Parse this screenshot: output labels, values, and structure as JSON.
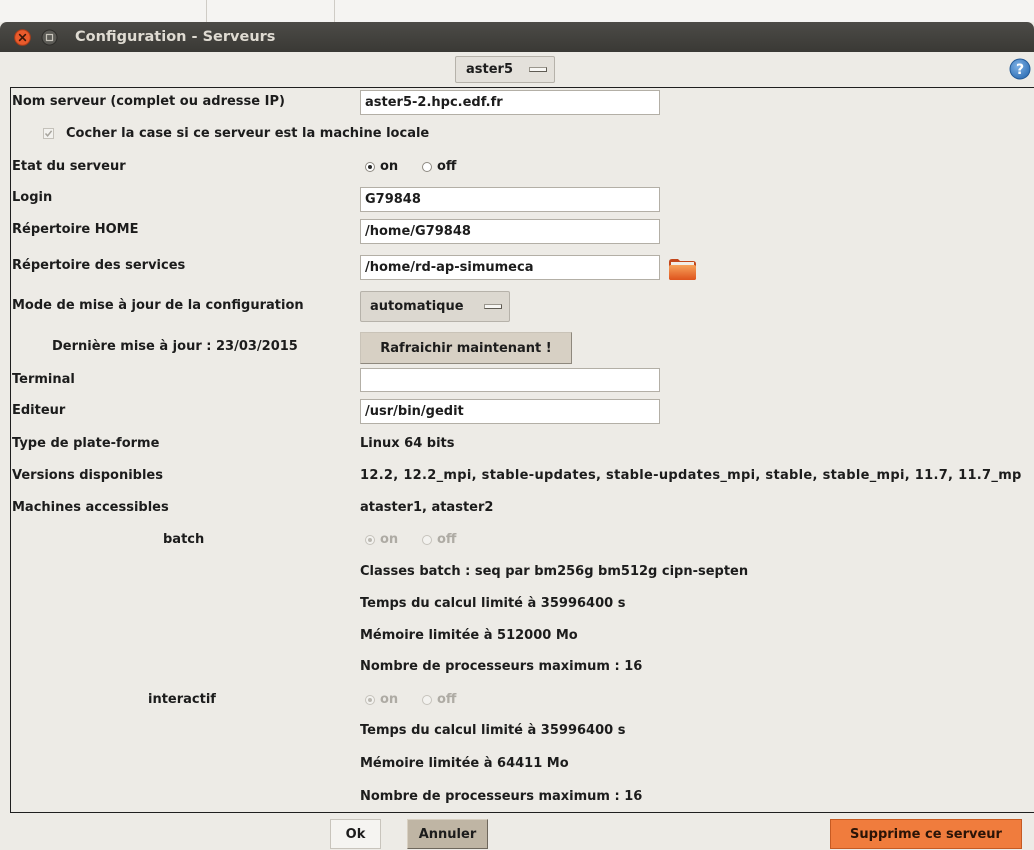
{
  "window": {
    "title": "Configuration - Serveurs",
    "icons": {
      "close": "close-icon",
      "maximize": "maximize-icon"
    }
  },
  "server_selector": {
    "value": "aster5",
    "icon": "menu-indicator-icon"
  },
  "help": {
    "icon": "help-icon"
  },
  "form": {
    "nom_serveur": {
      "label": "Nom serveur (complet ou adresse IP)",
      "value": "aster5-2.hpc.edf.fr"
    },
    "machine_locale": {
      "label": "Cocher la case si ce serveur est la machine locale",
      "checked": true,
      "disabled": true
    },
    "etat": {
      "label": "Etat du serveur",
      "options": [
        {
          "label": "on",
          "selected": true
        },
        {
          "label": "off",
          "selected": false
        }
      ]
    },
    "login": {
      "label": "Login",
      "value": "G79848"
    },
    "home": {
      "label": "Répertoire HOME",
      "value": "/home/G79848"
    },
    "services": {
      "label": "Répertoire des services",
      "value": "/home/rd-ap-simumeca",
      "icon": "folder-icon"
    },
    "mode": {
      "label": "Mode de mise à jour de la configuration",
      "value": "automatique"
    },
    "derniere_maj": {
      "label": "Dernière mise à jour : 23/03/2015",
      "button": "Rafraichir maintenant !"
    },
    "terminal": {
      "label": "Terminal",
      "value": ""
    },
    "editeur": {
      "label": "Editeur",
      "value": "/usr/bin/gedit"
    },
    "plateforme": {
      "label": "Type de plate-forme",
      "value": "Linux 64 bits"
    },
    "versions": {
      "label": "Versions disponibles",
      "value": "12.2, 12.2_mpi, stable-updates, stable-updates_mpi, stable, stable_mpi, 11.7, 11.7_mp"
    },
    "machines": {
      "label": "Machines accessibles",
      "value": "ataster1, ataster2"
    }
  },
  "batch": {
    "label": "batch",
    "disabled": true,
    "options": [
      {
        "label": "on",
        "selected": true
      },
      {
        "label": "off",
        "selected": false
      }
    ],
    "classes": "Classes batch : seq par bm256g bm512g cipn-septen",
    "temps": "Temps du calcul limité à 35996400 s",
    "memoire": "Mémoire limitée à 512000 Mo",
    "processeurs": "Nombre de processeurs maximum : 16"
  },
  "interactif": {
    "label": "interactif",
    "disabled": true,
    "options": [
      {
        "label": "on",
        "selected": true
      },
      {
        "label": "off",
        "selected": false
      }
    ],
    "temps": "Temps du calcul limité à 35996400 s",
    "memoire": "Mémoire limitée à 64411 Mo",
    "processeurs": "Nombre de processeurs maximum : 16"
  },
  "buttons": {
    "ok": "Ok",
    "annuler": "Annuler",
    "supprimer": "Supprime ce serveur"
  },
  "colors": {
    "titlebar": "#3c3b37",
    "background": "#edebe6",
    "accent": "#f07c3d",
    "close": "#e95b2c",
    "help": "#3b7fc4"
  }
}
